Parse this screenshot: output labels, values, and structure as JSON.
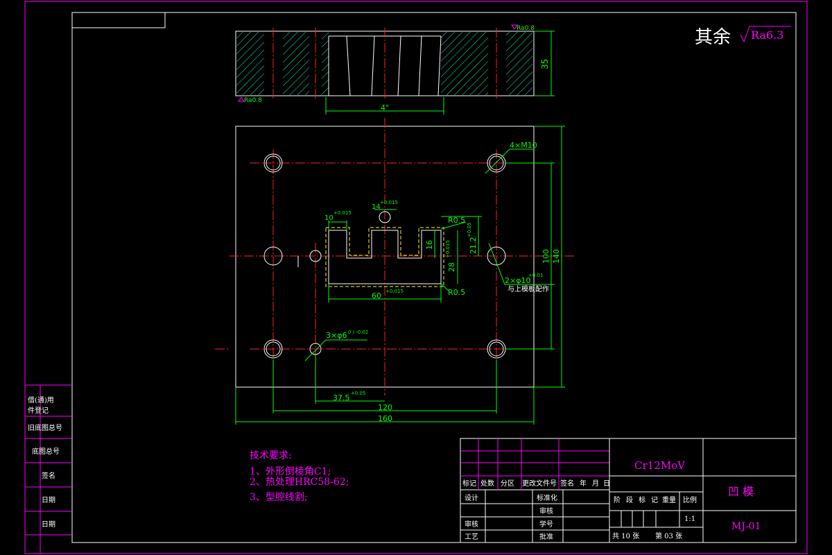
{
  "surface_note": {
    "prefix": "其余",
    "roughness": "Ra6.3"
  },
  "section_view": {
    "ra_top": "Ra0.8",
    "ra_bottom": "Ra0.8",
    "height_dim": "35",
    "angle_dim": "4°"
  },
  "plan_view": {
    "hole_callout": "4×M10",
    "slot_width": "10",
    "slot_width_tol": "+0.015",
    "pin_dia": "14",
    "pin_dia_tol": "+0.015",
    "radius_top": "R0.5",
    "radius_bottom": "R0.5",
    "depth_16": "16",
    "dim_21": "21.2",
    "dim_21_tol": "+0.05",
    "dim_28": "28",
    "dim_28_tol": "+0.015",
    "width_60": "60",
    "width_60_tol": "+0.015",
    "pin_callout": "2×φ10",
    "pin_callout_tol": "+0.01",
    "pin_note": "与上模板配作",
    "small_holes": "3×φ6",
    "small_holes_tol": "0 / -0.02",
    "dim_37": "37.5",
    "dim_37_tol": "+0.05",
    "dim_100": "100",
    "dim_140": "140",
    "dim_120": "120",
    "dim_160": "160"
  },
  "tech_requirements": {
    "title": "技术要求:",
    "items": [
      "1、外形倒棱角C1;",
      "2、热处理HRC58-62;",
      "3、型腔线割;"
    ]
  },
  "left_strip": [
    "借(通)用",
    "件登记",
    "旧底图总号",
    "底图总号",
    "签名",
    "日期",
    "日期"
  ],
  "title_block": {
    "material": "Cr12MoV",
    "part_name": "凹  模",
    "drawing_no": "MJ-01",
    "revision_header": [
      "标记",
      "处数",
      "分区",
      "更改文件号",
      "签名",
      "年",
      "月",
      "日"
    ],
    "design": "设计",
    "standardize": "标准化",
    "check": "审核",
    "review": "审核",
    "process": "工艺",
    "approve": "批准",
    "proofread": "审核",
    "date_mark": "学号",
    "stage_header": [
      "阶",
      "段",
      "标",
      "记",
      "重量",
      "比例"
    ],
    "scale": "1:1",
    "sheets": "共 10 张",
    "sheet_no": "第 03 张"
  }
}
